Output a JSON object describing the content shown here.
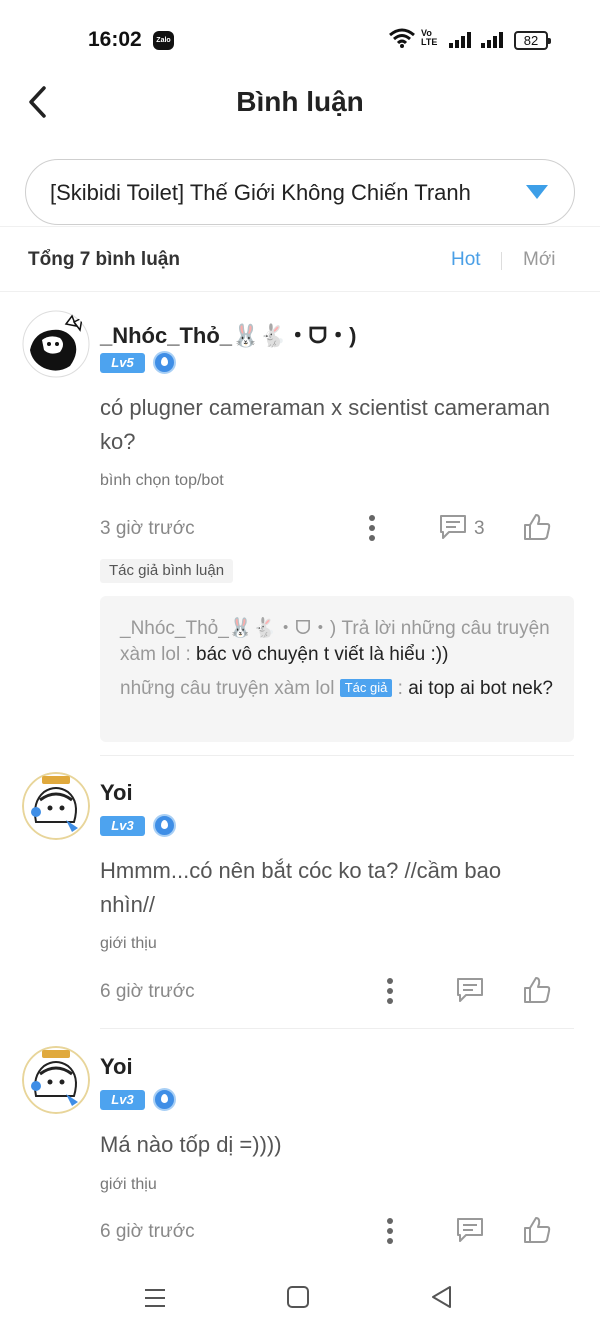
{
  "status_bar": {
    "time": "16:02",
    "zalo_label": "Zalo",
    "volte_top": "Vo",
    "volte_bottom": "LTE",
    "battery": "82"
  },
  "header": {
    "title": "Bình luận",
    "back_icon": "chevron-left-icon"
  },
  "chapter_selector": {
    "value": "[Skibidi Toilet] Thế Giới Không Chiến Tranh",
    "accent": "#3d9fe8"
  },
  "summary": {
    "total": "Tổng 7 bình luận",
    "sort_hot": "Hot",
    "sort_new": "Mới",
    "active_color": "#4a9fe6"
  },
  "comments": [
    {
      "username": "_Nhóc_Thỏ_🐰🐇・ᗜ・)",
      "level": "Lv5",
      "content": "có plugner cameraman x scientist cameraman ko?",
      "tag": "bình chọn top/bot",
      "time": "3 giờ trước",
      "reply_count": "3",
      "author_chip": "Tác giả bình luận",
      "replies": [
        {
          "author": "_Nhóc_Thỏ_🐰🐇・ᗜ・)",
          "action": " Trả lời những câu truyện xàm lol : ",
          "text": "bác vô chuyện t viết là hiểu :))"
        },
        {
          "author": "những câu truyện xàm lol",
          "badge": "Tác giả",
          "separator": " : ",
          "text": "ai top ai bot nek?"
        }
      ]
    },
    {
      "username": "Yoi",
      "level": "Lv3",
      "content": "Hmmm...có nên bắt cóc ko ta? //cầm bao nhìn//",
      "tag": "giới thịu",
      "time": "6 giờ trước"
    },
    {
      "username": "Yoi",
      "level": "Lv3",
      "content": "Má nào tốp dị =))))",
      "tag": "giới thịu",
      "time": "6 giờ trước"
    }
  ],
  "nav_bar": {
    "icons": [
      "menu-icon",
      "home-square-icon",
      "back-triangle-icon"
    ]
  }
}
